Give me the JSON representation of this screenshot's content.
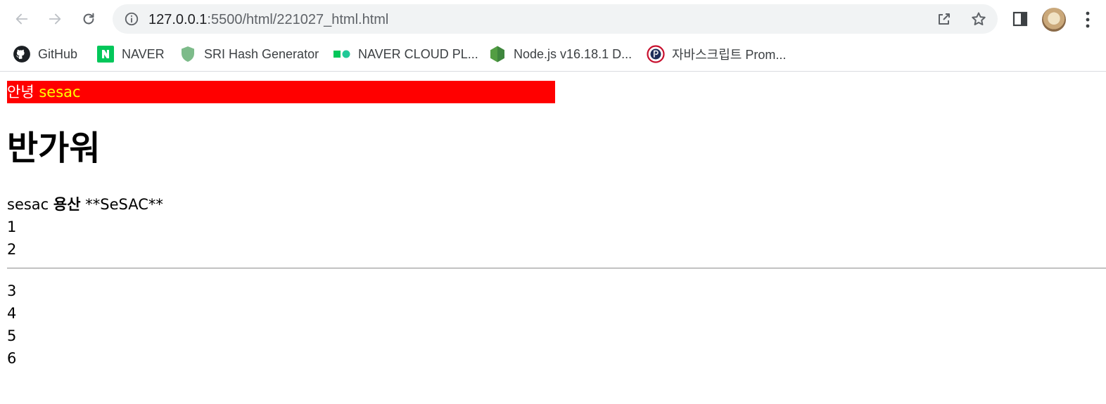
{
  "browser": {
    "url_host": "127.0.0.1",
    "url_path": ":5500/html/221027_html.html",
    "icons": {
      "back": "back-arrow-icon",
      "forward": "forward-arrow-icon",
      "reload": "reload-icon",
      "info": "info-icon",
      "share": "share-icon",
      "star": "star-icon",
      "side_panel": "side-panel-icon",
      "avatar": "profile-avatar",
      "menu": "kebab-menu-icon"
    }
  },
  "bookmarks": [
    {
      "label": "GitHub",
      "icon": "github-icon",
      "color": "#1b1f23"
    },
    {
      "label": "NAVER",
      "icon": "naver-icon",
      "color": "#03c75a"
    },
    {
      "label": "SRI Hash Generator",
      "icon": "shield-icon",
      "color": "#7dbb8a"
    },
    {
      "label": "NAVER CLOUD PL...",
      "icon": "naver-cloud-icon",
      "color": "#20c997"
    },
    {
      "label": "Node.js v16.18.1 D...",
      "icon": "nodejs-icon",
      "color": "#539e43"
    },
    {
      "label": "자바스크립트 Prom...",
      "icon": "p-circle-icon",
      "color": "#c8102e"
    }
  ],
  "page": {
    "banner_text": "안녕",
    "banner_highlight": "sesac",
    "banner_bg": "#ff0000",
    "banner_highlight_color": "#ffff00",
    "heading": "반가워",
    "line1_a": "sesac",
    "line1_bold": "용산",
    "line1_b": "**SeSAC**",
    "numbers_before_rule": [
      "1",
      "2"
    ],
    "numbers_after_rule": [
      "3",
      "4",
      "5",
      "6"
    ]
  }
}
